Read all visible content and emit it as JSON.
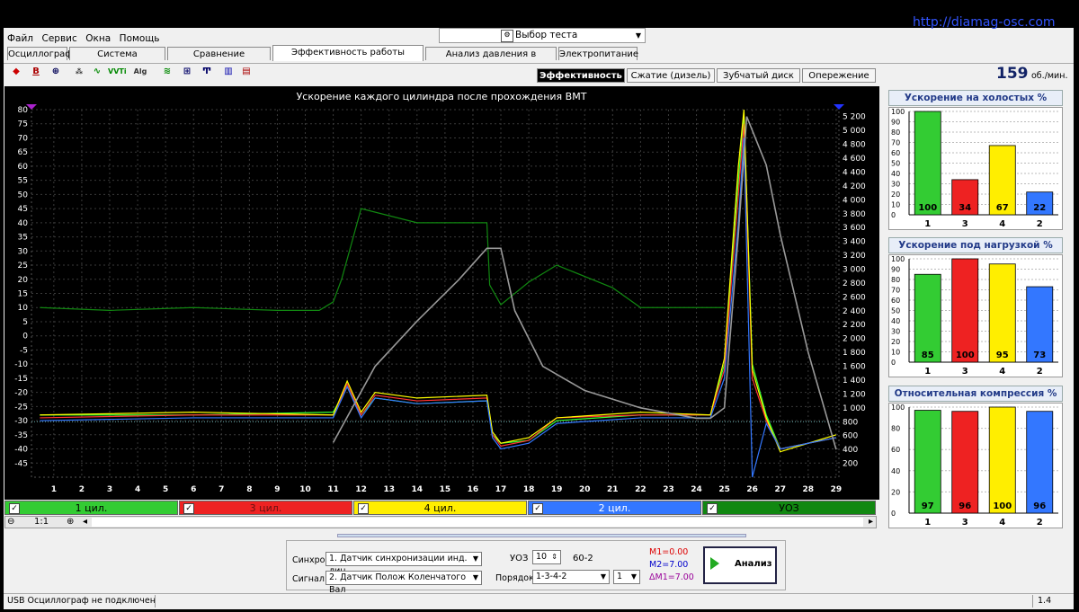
{
  "url_watermark": "http://diamag-osc.com",
  "menu": [
    "Файл",
    "Сервис",
    "Окна",
    "Помощь"
  ],
  "test_select": {
    "label": "Выбор теста",
    "icon": "wrench-icon"
  },
  "tabs": [
    {
      "label": "Осциллограф",
      "active": false
    },
    {
      "label": "Система зажигания",
      "active": false
    },
    {
      "label": "Сравнение цилиндров",
      "active": false
    },
    {
      "label": "Эффективность работы цилиндров",
      "active": true
    },
    {
      "label": "Анализ давления в цилиндре",
      "active": false
    },
    {
      "label": "Электропитание",
      "active": false
    }
  ],
  "toolbar_icons": [
    "cursor-icon",
    "bold-b-icon",
    "rpm-icon",
    "scale-icon",
    "signal-icon",
    "vvti-icon",
    "algo-icon",
    "filter-icon",
    "timer-icon",
    "trigger-icon",
    "bars-icon",
    "chart-icon"
  ],
  "sub_tabs": [
    {
      "label": "Эффективность",
      "active": true
    },
    {
      "label": "Сжатие (дизель)",
      "active": false
    },
    {
      "label": "Зубчатый диск",
      "active": false
    },
    {
      "label": "Опережение",
      "active": false
    }
  ],
  "rpm": {
    "value": "159",
    "unit": "об./мин."
  },
  "chart_title": "Ускорение каждого цилиндра после прохождения ВМТ",
  "cylinders": [
    {
      "label": "1 цил.",
      "color": "#33cc33",
      "text_color": "#000000"
    },
    {
      "label": "3 цил.",
      "color": "#ee2222",
      "text_color": "#661111"
    },
    {
      "label": "4 цил.",
      "color": "#ffee00",
      "text_color": "#000000"
    },
    {
      "label": "2 цил.",
      "color": "#3377ff",
      "text_color": "#ffffff"
    },
    {
      "label": "УОЗ",
      "color": "#118811",
      "text_color": "#000000"
    }
  ],
  "zoom": {
    "value": "1:1"
  },
  "panels": [
    {
      "title": "Ускорение на холостых %",
      "labels": [
        "1",
        "3",
        "4",
        "2"
      ],
      "values": [
        100,
        34,
        67,
        22
      ],
      "ticks": [
        "100",
        "90",
        "80",
        "70",
        "60",
        "50",
        "40",
        "30",
        "20",
        "10",
        "0"
      ]
    },
    {
      "title": "Ускорение под нагрузкой %",
      "labels": [
        "1",
        "3",
        "4",
        "2"
      ],
      "values": [
        85,
        100,
        95,
        73
      ],
      "ticks": [
        "100",
        "90",
        "80",
        "70",
        "60",
        "50",
        "40",
        "30",
        "20",
        "10",
        "0"
      ]
    },
    {
      "title": "Относительная компрессия %",
      "labels": [
        "1",
        "3",
        "4",
        "2"
      ],
      "values": [
        97,
        96,
        100,
        96
      ],
      "ticks": [
        "100",
        "80",
        "60",
        "40",
        "20",
        "0"
      ]
    }
  ],
  "controls": {
    "sync_label": "Синхро:",
    "sync_value": "1. Датчик синхронизации инд. лин",
    "signal_label": "Сигнал:",
    "signal_value": "2. Датчик Полож Коленчатого Вал",
    "uoz_label": "УОЗ",
    "uoz_value": "10",
    "teeth": "60-2",
    "order_label": "Порядок",
    "order_value": "1-3-4-2",
    "order_num": "1",
    "m1": "M1=0.00",
    "m2": "M2=7.00",
    "dm1": "ΔM1=7.00",
    "analyze": "Анализ"
  },
  "status": {
    "left": "USB Осциллограф не подключен",
    "right": "1.4"
  },
  "chart_data": {
    "type": "line",
    "title": "Ускорение каждого цилиндра после прохождения ВМТ",
    "xlabel": "",
    "ylabel": "",
    "x_ticks": [
      "1",
      "2",
      "3",
      "4",
      "5",
      "6",
      "7",
      "8",
      "9",
      "10",
      "11",
      "12",
      "13",
      "14",
      "15",
      "16",
      "17",
      "18",
      "19",
      "20",
      "21",
      "22",
      "23",
      "24",
      "25",
      "26",
      "27",
      "28",
      "29"
    ],
    "y_left_ticks": [
      "80",
      "75",
      "70",
      "65",
      "60",
      "55",
      "50",
      "45",
      "40",
      "35",
      "30",
      "25",
      "20",
      "15",
      "10",
      "5",
      "0",
      "-5",
      "-10",
      "-15",
      "-20",
      "-25",
      "-30",
      "-35",
      "-40",
      "-45"
    ],
    "y_right_ticks": [
      "5 200",
      "5 000",
      "4 800",
      "4 600",
      "4 400",
      "4 200",
      "4 000",
      "3 800",
      "3 600",
      "3 400",
      "3 200",
      "3 000",
      "2 800",
      "2 600",
      "2 400",
      "2 200",
      "2 000",
      "1 800",
      "1 600",
      "1 400",
      "1 200",
      "1 000",
      "800",
      "600",
      "400",
      "200"
    ],
    "ylim_left": [
      -50,
      80
    ],
    "ylim_right": [
      0,
      5300
    ],
    "grid": true,
    "series": [
      {
        "name": "1 цил.",
        "color": "#33ff33",
        "x": [
          0.5,
          6,
          11,
          11.5,
          12,
          12.5,
          14,
          16.5,
          16.7,
          17,
          18,
          19,
          22,
          24.5,
          25,
          25.5,
          25.7,
          26,
          26.5,
          27,
          28,
          29
        ],
        "y": [
          -28,
          -28,
          -27,
          -18,
          -28,
          -22,
          -24,
          -23,
          -35,
          -38,
          -37,
          -30,
          -28,
          -28,
          -10,
          55,
          78,
          -10,
          -28,
          -40,
          -38,
          -36
        ]
      },
      {
        "name": "3 цил.",
        "color": "#ff3333",
        "x": [
          0.5,
          6,
          11,
          11.5,
          12,
          12.5,
          14,
          16.5,
          16.7,
          17,
          18,
          19,
          22,
          24.5,
          25,
          25.5,
          25.7,
          26,
          26.5,
          27,
          28,
          29
        ],
        "y": [
          -29,
          -28,
          -28,
          -17,
          -28,
          -21,
          -23,
          -22,
          -35,
          -39,
          -37,
          -29,
          -28,
          -28,
          -12,
          50,
          75,
          -15,
          -30,
          -40,
          -38,
          -36
        ]
      },
      {
        "name": "4 цил.",
        "color": "#ffff00",
        "x": [
          0.5,
          6,
          11,
          11.5,
          12,
          12.5,
          14,
          16.5,
          16.7,
          17,
          18,
          19,
          22,
          24.5,
          25,
          25.5,
          25.7,
          26,
          26.5,
          27,
          28,
          29
        ],
        "y": [
          -28,
          -27,
          -28,
          -16,
          -27,
          -20,
          -22,
          -21,
          -34,
          -38,
          -36,
          -29,
          -27,
          -28,
          -8,
          60,
          80,
          -12,
          -29,
          -41,
          -38,
          -35
        ]
      },
      {
        "name": "2 цил.",
        "color": "#3377ff",
        "x": [
          0.5,
          6,
          11,
          11.5,
          12,
          12.5,
          14,
          16.5,
          16.7,
          17,
          18,
          19,
          22,
          24.5,
          25,
          25.5,
          25.7,
          26,
          26.5,
          27,
          28,
          29
        ],
        "y": [
          -30,
          -29,
          -29,
          -18,
          -29,
          -22,
          -24,
          -23,
          -36,
          -40,
          -38,
          -31,
          -29,
          -29,
          -15,
          40,
          70,
          -50,
          -31,
          -40,
          -38,
          -36
        ]
      },
      {
        "name": "УОЗ",
        "color": "#118811",
        "x": [
          0.5,
          3,
          6,
          9,
          10.5,
          11,
          11.3,
          12,
          14,
          16.5,
          16.6,
          17,
          18,
          19,
          21,
          22,
          24,
          24.5,
          25
        ],
        "y": [
          10,
          9,
          10,
          9,
          9,
          12,
          20,
          45,
          40,
          40,
          18,
          11,
          19,
          25,
          17,
          10,
          10,
          10,
          10
        ]
      },
      {
        "name": "rpm",
        "color": "#999999",
        "x": [
          11,
          12.5,
          14,
          15.5,
          16.5,
          17,
          17.5,
          18.5,
          20,
          22,
          24,
          24.5,
          25,
          25.5,
          25.8,
          26.5,
          27,
          28,
          29
        ],
        "y": [
          500,
          1600,
          2250,
          2850,
          3300,
          3300,
          2400,
          1600,
          1250,
          1000,
          850,
          850,
          1000,
          3500,
          5200,
          4500,
          3500,
          1800,
          400
        ]
      }
    ]
  }
}
